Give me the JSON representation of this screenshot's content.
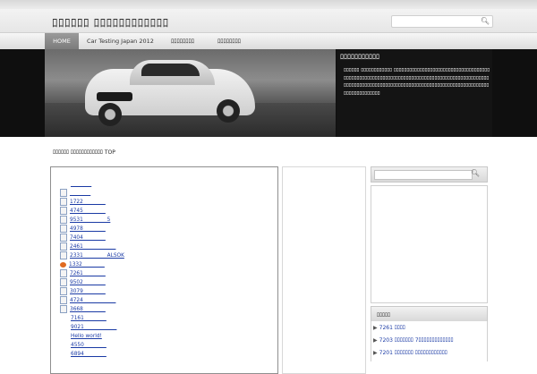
{
  "header": {
    "site_title": "ﾛﾛﾛﾛﾛﾛ ﾛﾛﾛﾛﾛﾛﾛﾛﾛﾛﾛﾛ",
    "search_placeholder": ""
  },
  "nav": {
    "items": [
      {
        "label": "HOME"
      },
      {
        "label": "Car Testing Japan 2012"
      },
      {
        "label": "ﾛﾛﾛﾛﾛﾛﾛﾛ"
      },
      {
        "label": "ﾛﾛﾛﾛﾛﾛﾛﾛ"
      }
    ]
  },
  "banner": {
    "title": "ﾛﾛﾛﾛﾛﾛﾛﾛﾛﾛﾛ",
    "description": "ﾛﾛﾛﾛﾛﾛ ﾛﾛﾛﾛﾛﾛﾛﾛﾛﾛﾛﾛ ﾛﾛﾛﾛﾛﾛﾛﾛﾛﾛﾛﾛﾛﾛﾛﾛﾛﾛﾛﾛﾛﾛﾛﾛﾛﾛﾛﾛﾛﾛﾛﾛﾛﾛﾛﾛﾛﾛﾛﾛﾛﾛﾛﾛﾛﾛﾛﾛﾛﾛﾛﾛﾛﾛﾛﾛﾛﾛﾛﾛﾛﾛﾛﾛﾛﾛﾛﾛﾛﾛﾛﾛﾛﾛﾛﾛﾛﾛﾛﾛﾛﾛﾛﾛﾛﾛﾛﾛﾛﾛﾛﾛﾛﾛﾛﾛﾛﾛﾛﾛﾛﾛﾛﾛﾛﾛﾛﾛﾛﾛﾛﾛﾛﾛﾛﾛﾛﾛﾛﾛﾛﾛﾛﾛﾛﾛﾛﾛﾛﾛﾛﾛﾛﾛﾛﾛﾛﾛﾛﾛﾛﾛﾛﾛﾛﾛﾛﾛﾛﾛﾛﾛﾛﾛﾛﾛﾛﾛﾛﾛﾛﾛﾛ"
  },
  "breadcrumb": {
    "text": "ﾛﾛﾛﾛﾛﾛ ﾛﾛﾛﾛﾛﾛﾛﾛﾛﾛﾛﾛ TOP"
  },
  "main_list": {
    "items": [
      {
        "label": "________",
        "icon": "none"
      },
      {
        "label": "________",
        "icon": "doc"
      },
      {
        "label": "1722 ________",
        "icon": "doc"
      },
      {
        "label": "4745 ________",
        "icon": "doc"
      },
      {
        "label": "9531 ________ 5",
        "icon": "doc"
      },
      {
        "label": "4978 ________",
        "icon": "doc"
      },
      {
        "label": "7404 ________",
        "icon": "doc"
      },
      {
        "label": "2461 ____________",
        "icon": "doc"
      },
      {
        "label": "2331 ________ ALSOK",
        "icon": "doc"
      },
      {
        "label": "1332 ________",
        "icon": "feed"
      },
      {
        "label": "7261 ________",
        "icon": "doc"
      },
      {
        "label": "9502 ________",
        "icon": "doc"
      },
      {
        "label": "3079 ________",
        "icon": "doc"
      },
      {
        "label": "4724 ____________",
        "icon": "doc"
      },
      {
        "label": "3668 ________",
        "icon": "doc"
      },
      {
        "label": "7161 ________",
        "icon": "none"
      },
      {
        "label": "9021 ____________",
        "icon": "none"
      },
      {
        "label": "Hello world!",
        "icon": "none"
      },
      {
        "label": "4550 ________",
        "icon": "none"
      },
      {
        "label": "6894 ________",
        "icon": "none"
      }
    ]
  },
  "sidebar": {
    "search_placeholder": "",
    "recent_heading": "ﾛﾛﾛﾛﾛ",
    "recent_items": [
      {
        "label": "7261 ﾛﾛﾛﾛ"
      },
      {
        "label": "7203 ﾛﾛﾛﾛﾛﾛﾛ 7ﾛﾛﾛﾛﾛﾛﾛﾛﾛﾛﾛﾛﾛ"
      },
      {
        "label": "7201 ﾛﾛﾛﾛﾛﾛﾛ ﾛﾛﾛﾛﾛﾛﾛﾛﾛﾛﾛﾛ"
      }
    ]
  },
  "colors": {
    "link": "#1a3aa5",
    "banner_bg": "#141414",
    "nav_active": "#8a8a8a"
  }
}
